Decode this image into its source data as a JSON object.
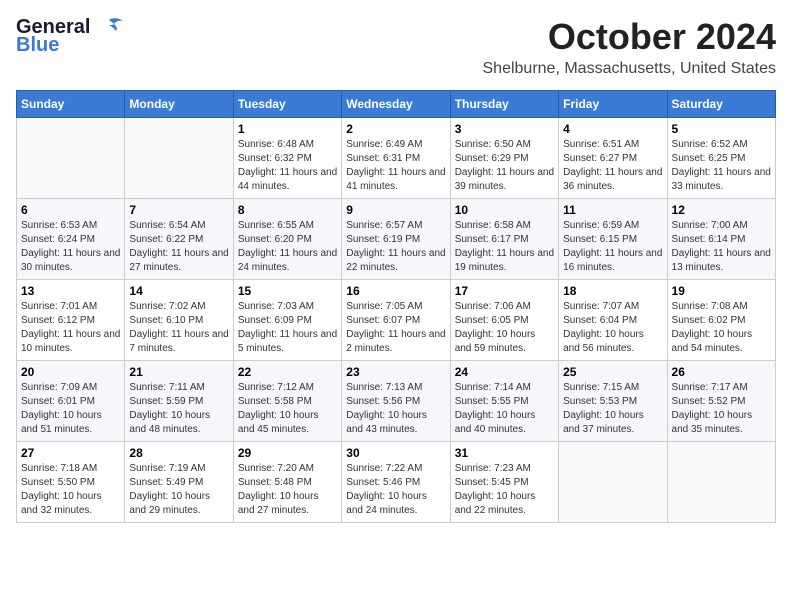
{
  "header": {
    "logo_line1": "General",
    "logo_line2": "Blue",
    "month": "October 2024",
    "location": "Shelburne, Massachusetts, United States"
  },
  "weekdays": [
    "Sunday",
    "Monday",
    "Tuesday",
    "Wednesday",
    "Thursday",
    "Friday",
    "Saturday"
  ],
  "weeks": [
    [
      {
        "day": "",
        "info": ""
      },
      {
        "day": "",
        "info": ""
      },
      {
        "day": "1",
        "info": "Sunrise: 6:48 AM\nSunset: 6:32 PM\nDaylight: 11 hours and 44 minutes."
      },
      {
        "day": "2",
        "info": "Sunrise: 6:49 AM\nSunset: 6:31 PM\nDaylight: 11 hours and 41 minutes."
      },
      {
        "day": "3",
        "info": "Sunrise: 6:50 AM\nSunset: 6:29 PM\nDaylight: 11 hours and 39 minutes."
      },
      {
        "day": "4",
        "info": "Sunrise: 6:51 AM\nSunset: 6:27 PM\nDaylight: 11 hours and 36 minutes."
      },
      {
        "day": "5",
        "info": "Sunrise: 6:52 AM\nSunset: 6:25 PM\nDaylight: 11 hours and 33 minutes."
      }
    ],
    [
      {
        "day": "6",
        "info": "Sunrise: 6:53 AM\nSunset: 6:24 PM\nDaylight: 11 hours and 30 minutes."
      },
      {
        "day": "7",
        "info": "Sunrise: 6:54 AM\nSunset: 6:22 PM\nDaylight: 11 hours and 27 minutes."
      },
      {
        "day": "8",
        "info": "Sunrise: 6:55 AM\nSunset: 6:20 PM\nDaylight: 11 hours and 24 minutes."
      },
      {
        "day": "9",
        "info": "Sunrise: 6:57 AM\nSunset: 6:19 PM\nDaylight: 11 hours and 22 minutes."
      },
      {
        "day": "10",
        "info": "Sunrise: 6:58 AM\nSunset: 6:17 PM\nDaylight: 11 hours and 19 minutes."
      },
      {
        "day": "11",
        "info": "Sunrise: 6:59 AM\nSunset: 6:15 PM\nDaylight: 11 hours and 16 minutes."
      },
      {
        "day": "12",
        "info": "Sunrise: 7:00 AM\nSunset: 6:14 PM\nDaylight: 11 hours and 13 minutes."
      }
    ],
    [
      {
        "day": "13",
        "info": "Sunrise: 7:01 AM\nSunset: 6:12 PM\nDaylight: 11 hours and 10 minutes."
      },
      {
        "day": "14",
        "info": "Sunrise: 7:02 AM\nSunset: 6:10 PM\nDaylight: 11 hours and 7 minutes."
      },
      {
        "day": "15",
        "info": "Sunrise: 7:03 AM\nSunset: 6:09 PM\nDaylight: 11 hours and 5 minutes."
      },
      {
        "day": "16",
        "info": "Sunrise: 7:05 AM\nSunset: 6:07 PM\nDaylight: 11 hours and 2 minutes."
      },
      {
        "day": "17",
        "info": "Sunrise: 7:06 AM\nSunset: 6:05 PM\nDaylight: 10 hours and 59 minutes."
      },
      {
        "day": "18",
        "info": "Sunrise: 7:07 AM\nSunset: 6:04 PM\nDaylight: 10 hours and 56 minutes."
      },
      {
        "day": "19",
        "info": "Sunrise: 7:08 AM\nSunset: 6:02 PM\nDaylight: 10 hours and 54 minutes."
      }
    ],
    [
      {
        "day": "20",
        "info": "Sunrise: 7:09 AM\nSunset: 6:01 PM\nDaylight: 10 hours and 51 minutes."
      },
      {
        "day": "21",
        "info": "Sunrise: 7:11 AM\nSunset: 5:59 PM\nDaylight: 10 hours and 48 minutes."
      },
      {
        "day": "22",
        "info": "Sunrise: 7:12 AM\nSunset: 5:58 PM\nDaylight: 10 hours and 45 minutes."
      },
      {
        "day": "23",
        "info": "Sunrise: 7:13 AM\nSunset: 5:56 PM\nDaylight: 10 hours and 43 minutes."
      },
      {
        "day": "24",
        "info": "Sunrise: 7:14 AM\nSunset: 5:55 PM\nDaylight: 10 hours and 40 minutes."
      },
      {
        "day": "25",
        "info": "Sunrise: 7:15 AM\nSunset: 5:53 PM\nDaylight: 10 hours and 37 minutes."
      },
      {
        "day": "26",
        "info": "Sunrise: 7:17 AM\nSunset: 5:52 PM\nDaylight: 10 hours and 35 minutes."
      }
    ],
    [
      {
        "day": "27",
        "info": "Sunrise: 7:18 AM\nSunset: 5:50 PM\nDaylight: 10 hours and 32 minutes."
      },
      {
        "day": "28",
        "info": "Sunrise: 7:19 AM\nSunset: 5:49 PM\nDaylight: 10 hours and 29 minutes."
      },
      {
        "day": "29",
        "info": "Sunrise: 7:20 AM\nSunset: 5:48 PM\nDaylight: 10 hours and 27 minutes."
      },
      {
        "day": "30",
        "info": "Sunrise: 7:22 AM\nSunset: 5:46 PM\nDaylight: 10 hours and 24 minutes."
      },
      {
        "day": "31",
        "info": "Sunrise: 7:23 AM\nSunset: 5:45 PM\nDaylight: 10 hours and 22 minutes."
      },
      {
        "day": "",
        "info": ""
      },
      {
        "day": "",
        "info": ""
      }
    ]
  ]
}
